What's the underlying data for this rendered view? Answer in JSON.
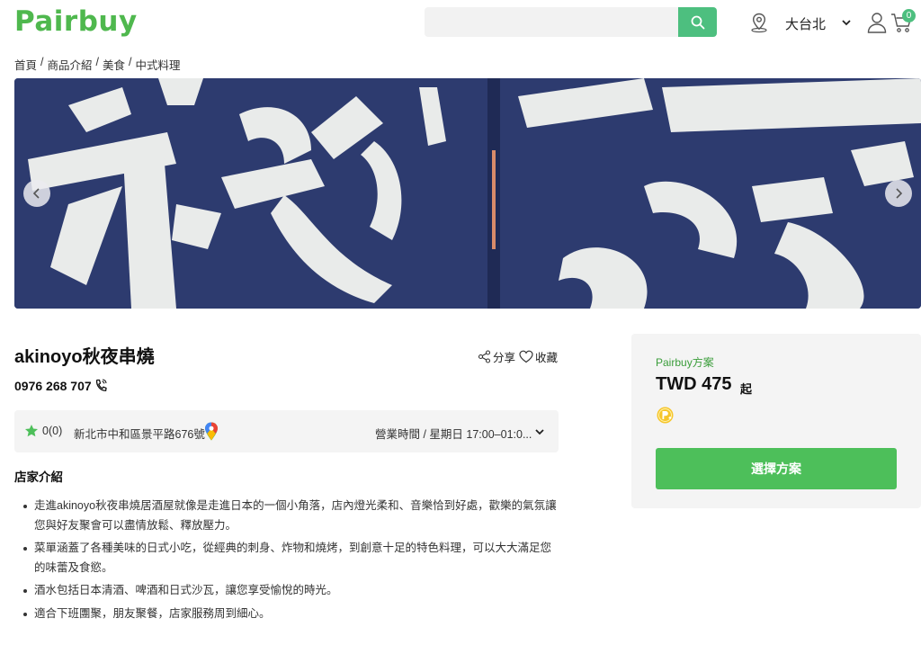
{
  "header": {
    "logo": "Pairbuy",
    "search_placeholder": "",
    "region": "大台北",
    "cart_count": "0"
  },
  "breadcrumb": [
    "首頁",
    "商品介紹",
    "美食",
    "中式料理"
  ],
  "store": {
    "name": "akinoyo秋夜串燒",
    "share_label": "分享",
    "favorite_label": "收藏",
    "phone": "0976 268 707",
    "rating": "0(0)",
    "address": "新北市中和區景平路676號",
    "hours": "營業時間 / 星期日 17:00–01:0..."
  },
  "intro": {
    "title": "店家介紹",
    "items": [
      "走進akinoyo秋夜串燒居酒屋就像是走進日本的一個小角落，店內燈光柔和、音樂恰到好處，歡樂的氣氛讓您與好友聚會可以盡情放鬆、釋放壓力。",
      "菜單涵蓋了各種美味的日式小吃，從經典的刺身、炸物和燒烤，到創意十足的特色料理，可以大大滿足您的味蕾及食慾。",
      "酒水包括日本清酒、啤酒和日式沙瓦，讓您享受愉悅的時光。",
      "適合下班團聚，朋友聚餐，店家服務周到細心。"
    ]
  },
  "plan": {
    "label": "Pairbuy方案",
    "price": "TWD 475",
    "suffix": "起",
    "select_label": "選擇方案"
  },
  "colors": {
    "brand_green": "#4fb84e",
    "button_green": "#4dbf5a",
    "search_button": "#4dbf7f",
    "curtain_navy": "#2c3a6e"
  },
  "icons": [
    "search-icon",
    "location-pin-icon",
    "chevron-down-icon",
    "user-icon",
    "cart-icon",
    "chevron-left-icon",
    "chevron-right-icon",
    "share-icon",
    "heart-icon",
    "phone-icon",
    "star-icon",
    "map-pin-icon",
    "points-icon"
  ]
}
